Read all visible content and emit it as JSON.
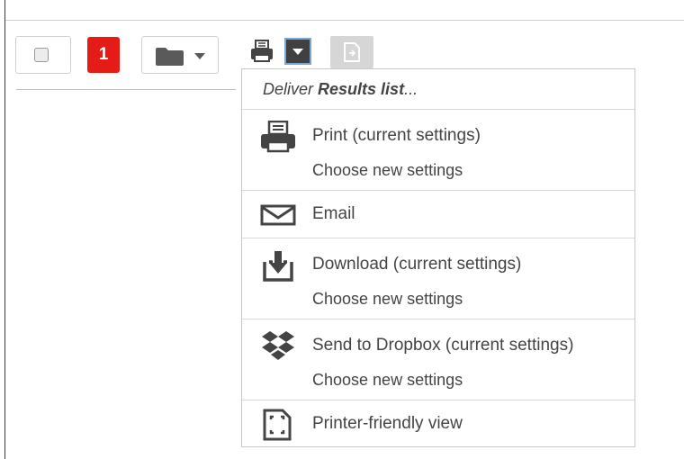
{
  "toolbar": {
    "selected_count": "1"
  },
  "menu": {
    "header_prefix": "Deliver",
    "header_bold": "Results list",
    "header_suffix": "...",
    "print_current": "Print (current settings)",
    "print_choose": "Choose new settings",
    "email": "Email",
    "download_current": "Download (current settings)",
    "download_choose": "Choose new settings",
    "dropbox_current": "Send to Dropbox (current settings)",
    "dropbox_choose": "Choose new settings",
    "printer_friendly": "Printer-friendly view"
  },
  "icons": {
    "select": "checkbox-icon",
    "folder": "folder-icon",
    "print": "printer-icon",
    "dropdown": "caret-down-icon",
    "export": "export-document-icon",
    "email": "envelope-icon",
    "download": "download-tray-icon",
    "dropbox": "dropbox-icon",
    "friendly": "printer-friendly-page-icon"
  },
  "colors": {
    "badge": "#e41b17",
    "active_toggle": "#404040",
    "text": "#444444"
  }
}
